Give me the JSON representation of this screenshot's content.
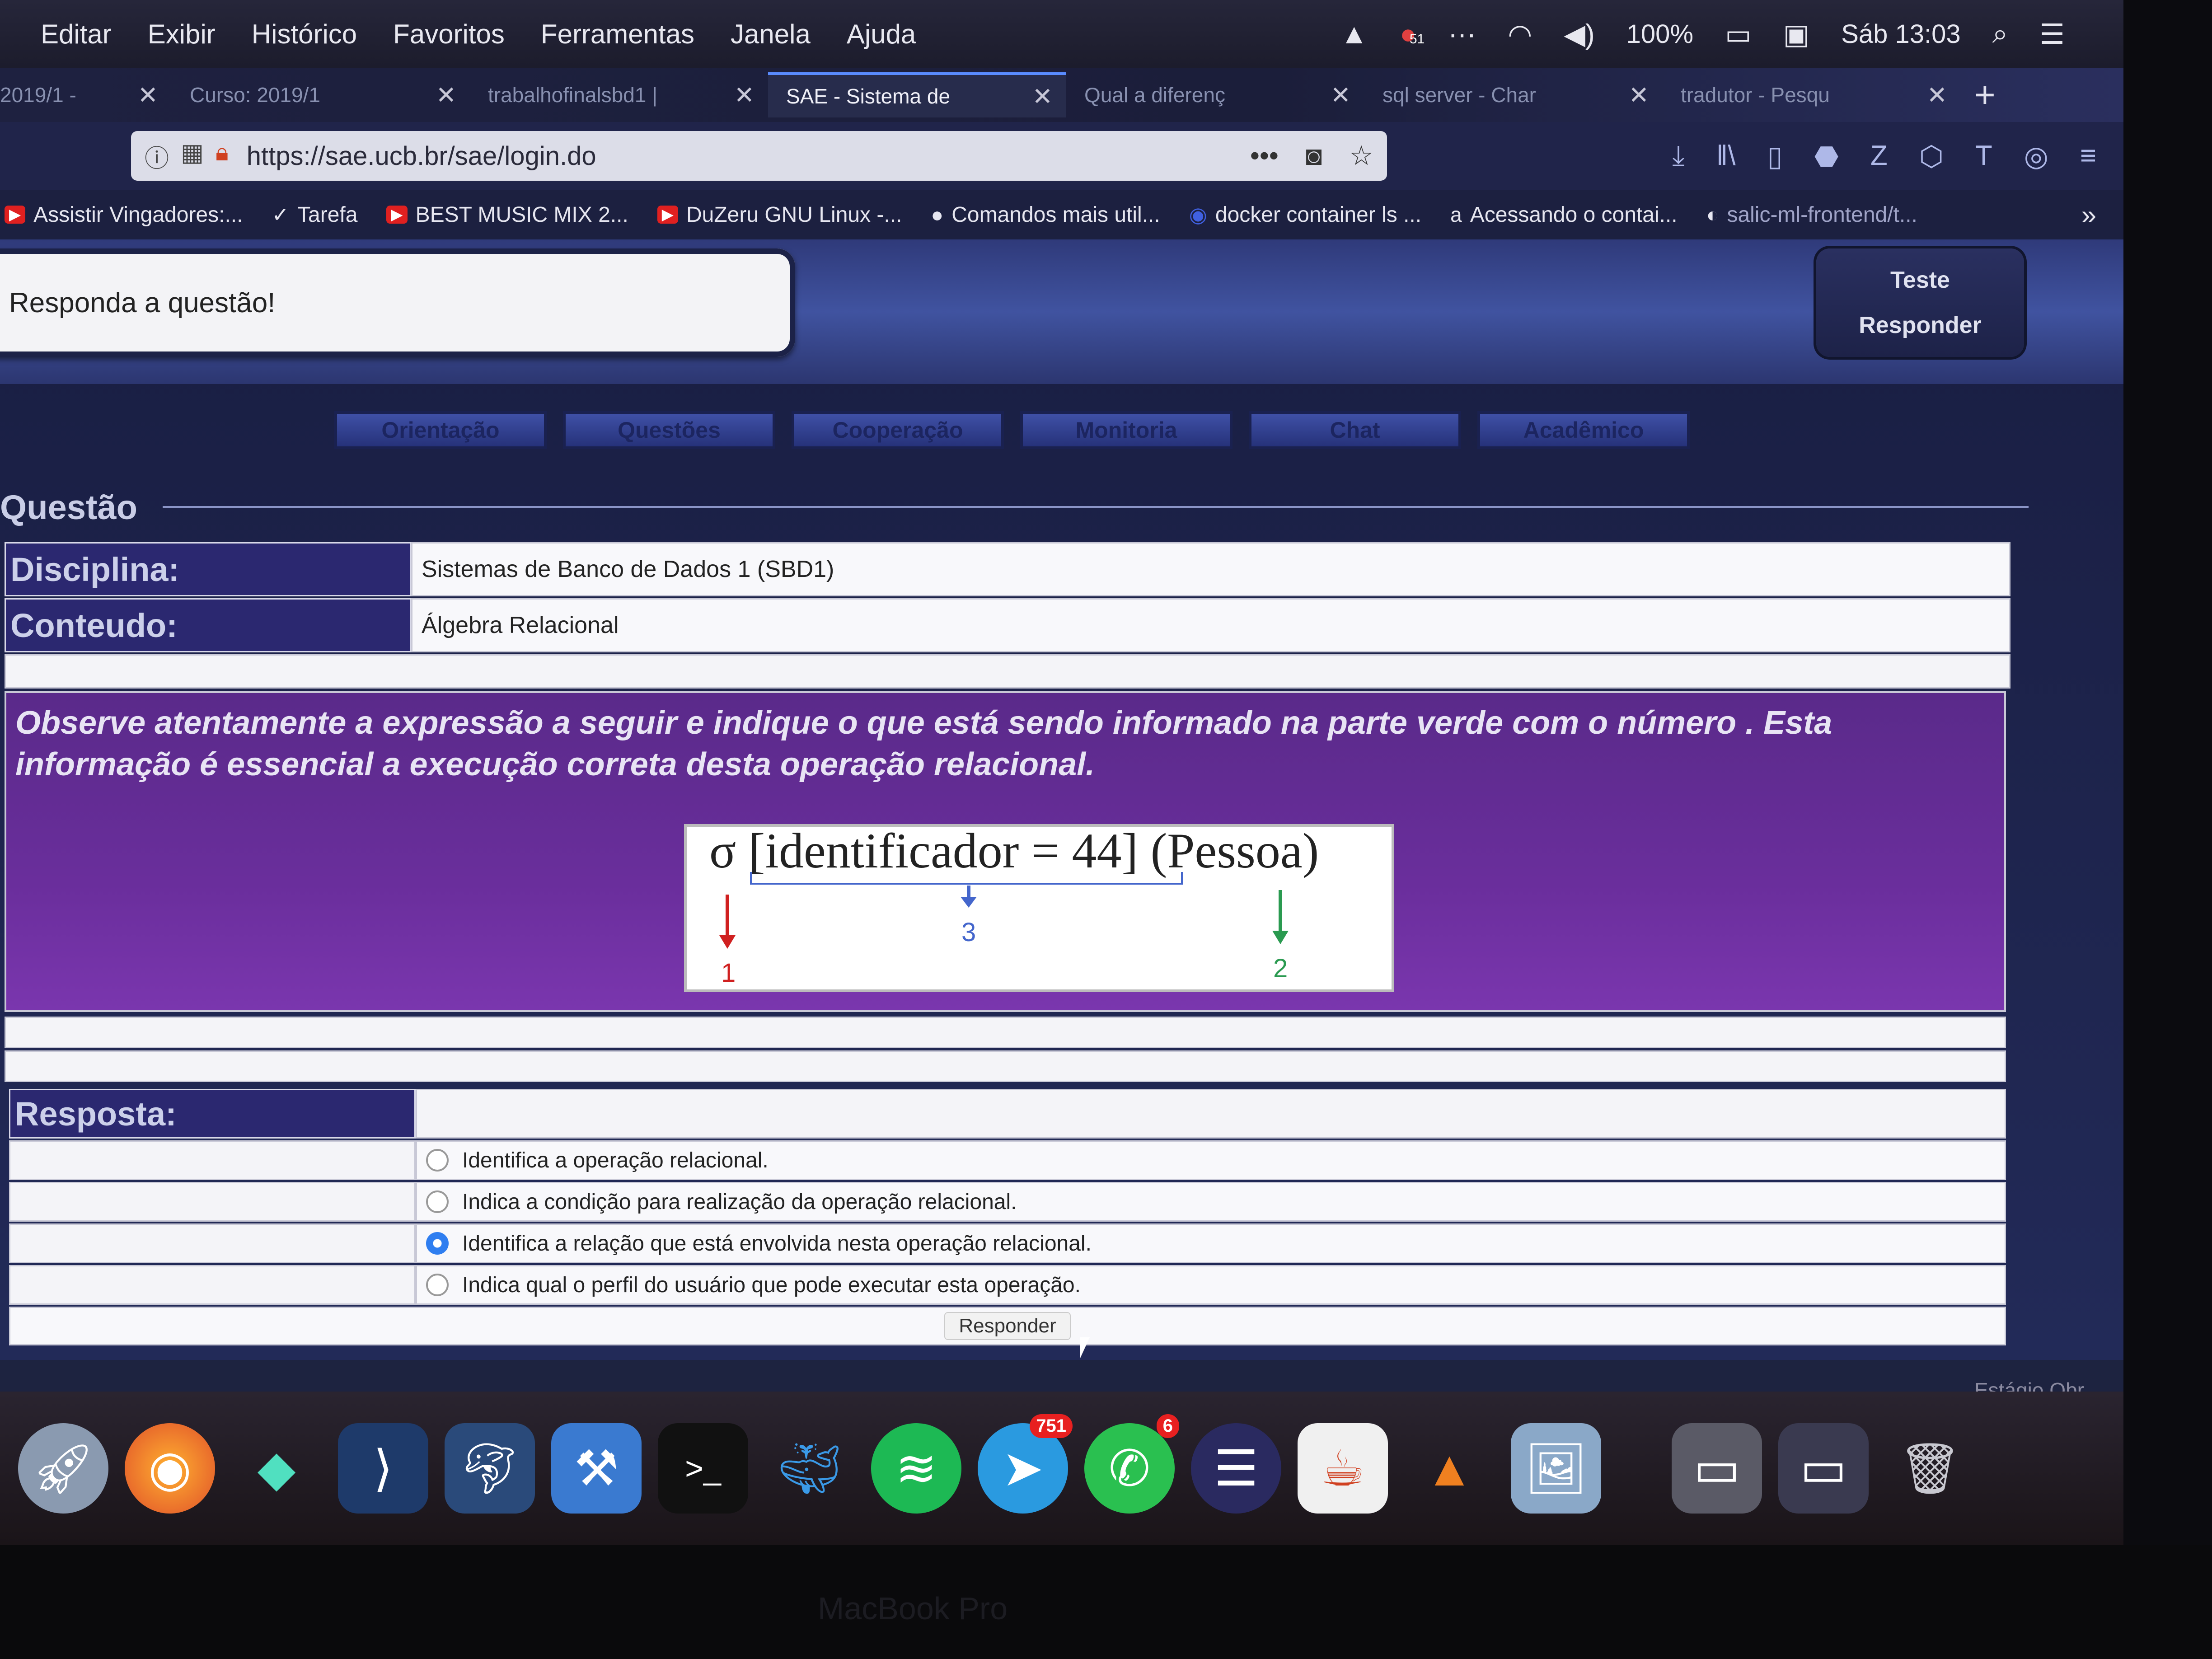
{
  "menubar": {
    "items": [
      "Editar",
      "Exibir",
      "Histórico",
      "Favoritos",
      "Ferramentas",
      "Janela",
      "Ajuda"
    ],
    "battery": "100%",
    "clock": "Sáb 13:03",
    "notification_count": "51"
  },
  "tabs": [
    {
      "label": "2019/1 -"
    },
    {
      "label": "Curso: 2019/1"
    },
    {
      "label": "trabalhofinalsbd1 |"
    },
    {
      "label": "SAE - Sistema de"
    },
    {
      "label": "Qual a diferenç"
    },
    {
      "label": "sql server - Char"
    },
    {
      "label": "tradutor - Pesqu"
    }
  ],
  "url": "https://sae.ucb.br/sae/login.do",
  "bookmarks": [
    "Assistir Vingadores:...",
    "Tarefa",
    "BEST MUSIC MIX 2...",
    "DuZeru GNU Linux -...",
    "Comandos mais util...",
    "docker container ls ...",
    "Acessando o contai...",
    "salic-ml-frontend/t..."
  ],
  "page": {
    "message": "Responda a questão!",
    "side_buttons": [
      "Teste",
      "Responder"
    ],
    "nav_tabs": [
      "Orientação",
      "Questões",
      "Cooperação",
      "Monitoria",
      "Chat",
      "Acadêmico"
    ],
    "section_title": "Questão",
    "disciplina_label": "Disciplina:",
    "disciplina_value": "Sistemas de Banco de Dados 1 (SBD1)",
    "conteudo_label": "Conteudo:",
    "conteudo_value": "Álgebra Relacional",
    "question_text": "Observe atentamente a expressão a seguir e indique o que está sendo informado na parte verde com o número . Esta informação é essencial a execução correta desta operação relacional.",
    "formula": "σ [identificador = 44] (Pessoa)",
    "marker_1": "1",
    "marker_2": "2",
    "marker_3": "3",
    "resposta_label": "Resposta:",
    "options": [
      {
        "text": "Identifica a operação relacional.",
        "selected": false
      },
      {
        "text": "Indica a condição para realização da operação relacional.",
        "selected": false
      },
      {
        "text": "Identifica a relação que está envolvida nesta operação relacional.",
        "selected": true
      },
      {
        "text": "Indica qual o perfil do usuário que pode executar esta operação.",
        "selected": false
      }
    ],
    "submit_label": "Responder",
    "corner_text": "Estágio Obr"
  },
  "dock": {
    "telegram_badge": "751",
    "whatsapp_badge": "6"
  },
  "bezel_label": "MacBook Pro"
}
